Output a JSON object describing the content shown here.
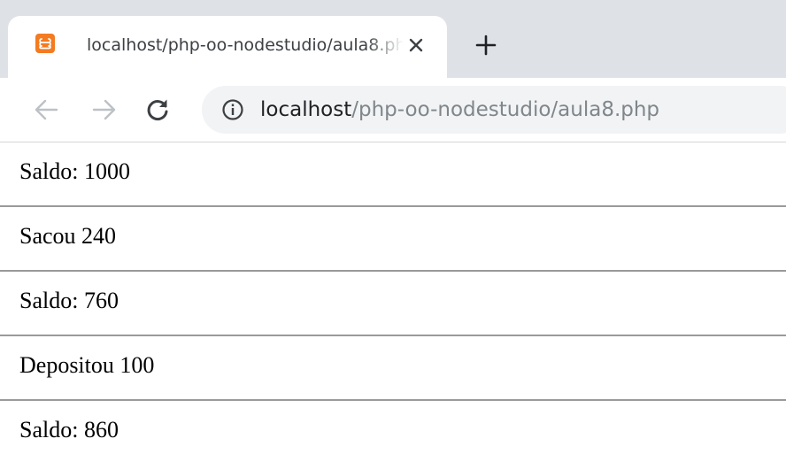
{
  "tab": {
    "title": "localhost/php-oo-nodestudio/aula8.php",
    "favicon": "xampp-icon",
    "favicon_color": "#f47b20"
  },
  "toolbar": {
    "back_icon": "arrow-left-icon",
    "forward_icon": "arrow-right-icon",
    "reload_icon": "reload-icon"
  },
  "address_bar": {
    "host": "localhost",
    "path": "/php-oo-nodestudio/aula8.php",
    "info_icon": "info-icon"
  },
  "page": {
    "lines": [
      {
        "text": "Saldo: 1000"
      },
      {
        "text": "Sacou 240"
      },
      {
        "text": "Saldo: 760"
      },
      {
        "text": "Depositou 100"
      },
      {
        "text": "Saldo: 860"
      }
    ]
  }
}
